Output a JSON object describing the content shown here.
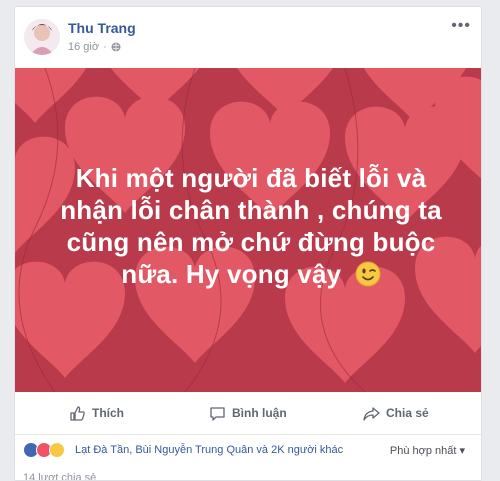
{
  "post": {
    "author": "Thu Trang",
    "time": "16 giờ",
    "more_icon": "more-dots-icon",
    "message": "Khi một người đã biết lỗi và nhận lỗi chân thành , chúng ta cũng nên mở chứ đừng buộc nữa. Hy vọng vậy",
    "message_lines": [
      "Khi một người đã biết lỗi và",
      "nhận lỗi chân thành , chúng ta",
      "cũng nên mở chứ đừng buộc",
      "nữa. Hy vọng vậy"
    ],
    "emoji_icon": "wink-emoji-icon",
    "background_color": "#b83a4b",
    "heart_color": "#e45a66"
  },
  "actions": {
    "like": "Thích",
    "comment": "Bình luận",
    "share": "Chia sẻ"
  },
  "reactions": {
    "icons": [
      "like-reaction-icon",
      "love-reaction-icon",
      "wow-reaction-icon"
    ],
    "summary": "Lạt Đà Tần, Bùi Nguyễn Trung Quân và 2K người khác",
    "sort": "Phù hợp nhất",
    "shares": "14 lượt chia sẻ"
  }
}
